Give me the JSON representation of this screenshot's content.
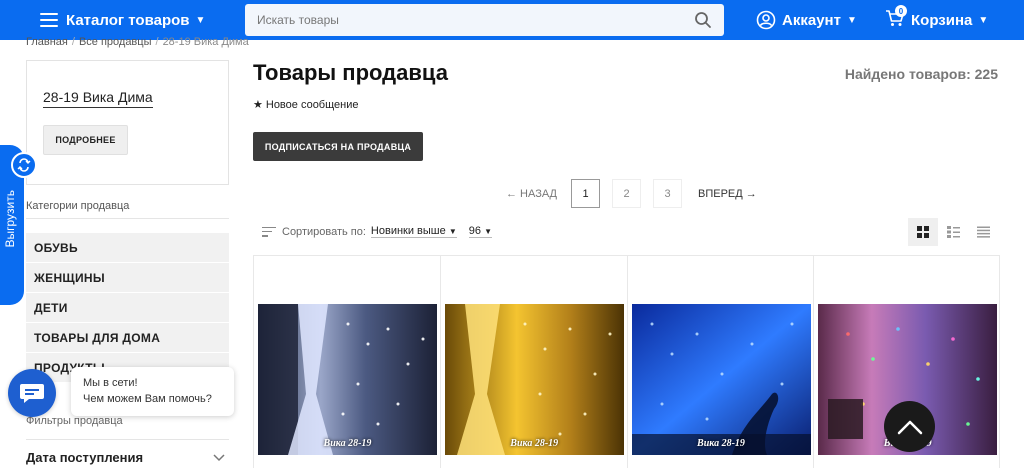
{
  "header": {
    "catalog_label": "Каталог товаров",
    "search_placeholder": "Искать товары",
    "account_label": "Аккаунт",
    "cart_label": "Корзина",
    "cart_count": "0",
    "brand_color": "#0a6cf0"
  },
  "breadcrumb": {
    "items": [
      "Главная",
      "Все продавцы",
      "28-19 Вика Дима"
    ]
  },
  "sidebar": {
    "seller_name": "28-19 Вика Дима",
    "details_button": "ПОДРОБНЕЕ",
    "categories_title": "Категории продавца",
    "categories": [
      "ОБУВЬ",
      "ЖЕНЩИНЫ",
      "ДЕТИ",
      "ТОВАРЫ ДЛЯ ДОМА",
      "ПРОДУКТЫ"
    ],
    "filters_title": "Фильтры продавца",
    "date_filter_label": "Дата поступления"
  },
  "export_tab": {
    "label": "Выгрузить"
  },
  "chat": {
    "line1": "Мы в сети!",
    "line2": "Чем можем Вам помочь?"
  },
  "main": {
    "title": "Товары продавца",
    "found_label": "Найдено товаров: 225",
    "new_message": "Новое сообщение",
    "subscribe_button": "ПОДПИСАТЬСЯ НА ПРОДАВЦА",
    "pagination": {
      "prev": "← НАЗАД",
      "pages": [
        "1",
        "2",
        "3"
      ],
      "active_page": "1",
      "next": "ВПЕРЕД →"
    },
    "sort": {
      "label": "Сортировать по:",
      "value": "Новинки выше",
      "per_page": "96"
    },
    "products": [
      {
        "caption": "Вика 28-19",
        "palette": "white"
      },
      {
        "caption": "Вика 28-19",
        "palette": "gold"
      },
      {
        "caption": "Вика 28-19",
        "palette": "blue"
      },
      {
        "caption": "Вика 28-19",
        "palette": "multicolor"
      }
    ]
  }
}
